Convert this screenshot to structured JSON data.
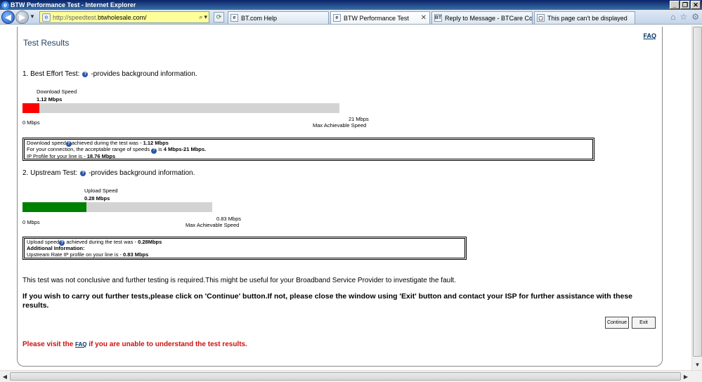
{
  "window": {
    "title": "BTW Performance Test - Internet Explorer"
  },
  "address": {
    "url_prefix": "http://speedtest.",
    "url_host": "btwholesale.com/"
  },
  "tabs": [
    {
      "label": "BT.com Help"
    },
    {
      "label": "BTW Performance Test"
    },
    {
      "label": "Reply to Message - BTCare Com..."
    },
    {
      "label": "This page can't be displayed"
    }
  ],
  "page": {
    "faq_label": "FAQ",
    "title": "Test Results",
    "best_effort": {
      "heading": "1. Best Effort Test:",
      "heading_suffix": "-provides background information.",
      "label": "Download  Speed",
      "value": "1.12 Mbps",
      "fill_fraction": 0.0533,
      "fill_color": "#ff0000",
      "min_label": "0 Mbps",
      "max_value": "21 Mbps",
      "max_label": "Max Achievable Speed",
      "info": {
        "line1_prefix": "Download speed",
        "line1_mid": "achieved during the test was - ",
        "line1_value": "1.12 Mbps",
        "line2_prefix": "For your connection, the acceptable range of speeds",
        "line2_mid": " is ",
        "line2_value": "4 Mbps-21 Mbps.",
        "line3_prefix": "IP Profile for your line is - ",
        "line3_value": "18.76 Mbps"
      }
    },
    "upstream": {
      "heading": "2. Upstream Test:",
      "heading_suffix": "-provides background information.",
      "label": "Upload Speed",
      "value": "0.28 Mbps",
      "fill_fraction": 0.337,
      "fill_color": "#008000",
      "min_label": "0 Mbps",
      "max_value": "0.83 Mbps",
      "max_label": "Max Achievable Speed",
      "info": {
        "line1_prefix": "Upload speed",
        "line1_mid": " achieved during the test was - ",
        "line1_value": "0.28Mbps",
        "line2": "Additional Information:",
        "line3_prefix": "Upstream Rate IP profile on your line is - ",
        "line3_value": "0.83 Mbps"
      }
    },
    "message1": "This test was not conclusive and further testing is required.This might be useful for your Broadband Service Provider to investigate the fault.",
    "message2": "If you wish to carry out further tests,please click on 'Continue' button.If not, please close the window using 'Exit' button and contact your ISP for further assistance with these results.",
    "continue_label": "Continue",
    "exit_label": "Exit",
    "faq_msg_prefix": "Please visit the ",
    "faq_msg_link": "FAQ",
    "faq_msg_suffix": " if you are unable to understand the test results."
  }
}
